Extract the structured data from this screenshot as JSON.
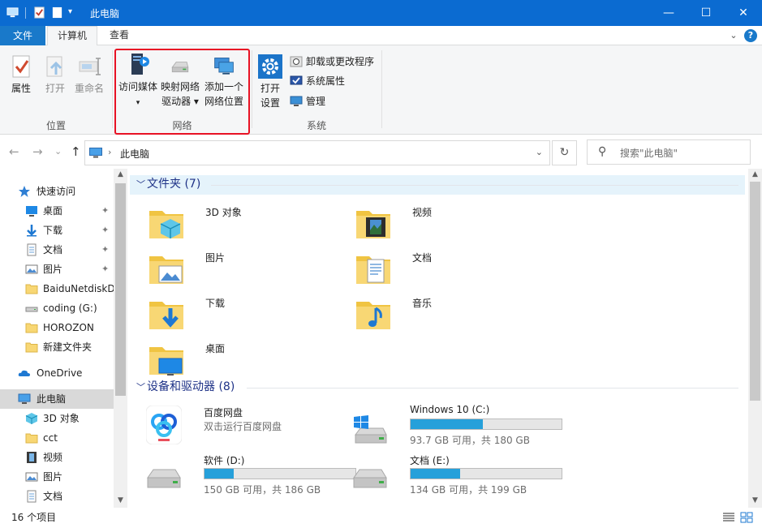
{
  "window": {
    "title": "此电脑",
    "minimize_glyph": "—",
    "maximize_glyph": "☐",
    "close_glyph": "✕"
  },
  "tabs": {
    "file": "文件",
    "computer": "计算机",
    "view": "查看",
    "active": "计算机",
    "expand_glyph": "⌄",
    "help_glyph": "?"
  },
  "ribbon": {
    "location": {
      "label": "位置",
      "properties": "属性",
      "open": "打开",
      "rename": "重命名"
    },
    "network": {
      "label": "网络",
      "access_media": "访问媒体",
      "map_drive_line1": "映射网络",
      "map_drive_line2": "驱动器 ▾",
      "add_location_line1": "添加一个",
      "add_location_line2": "网络位置",
      "dropdown_glyph": "▾"
    },
    "system": {
      "label": "系统",
      "open_settings_line1": "打开",
      "open_settings_line2": "设置",
      "uninstall": "卸载或更改程序",
      "system_properties": "系统属性",
      "manage": "管理"
    }
  },
  "address": {
    "back_glyph": "←",
    "forward_glyph": "→",
    "recent_glyph": "⌄",
    "up_glyph": "↑",
    "crumb_sep": "›",
    "path": "此电脑",
    "dropdown_glyph": "⌄",
    "refresh_glyph": "↻",
    "search_glyph": "⚲",
    "search_placeholder": "搜索\"此电脑\""
  },
  "nav": {
    "items": [
      {
        "label": "快速访问",
        "icon": "star-icon",
        "pinned": false
      },
      {
        "label": "桌面",
        "icon": "desktop-icon",
        "pinned": true
      },
      {
        "label": "下载",
        "icon": "download-icon",
        "pinned": true
      },
      {
        "label": "文档",
        "icon": "document-icon",
        "pinned": true
      },
      {
        "label": "图片",
        "icon": "picture-icon",
        "pinned": true
      },
      {
        "label": "BaiduNetdiskD",
        "icon": "folder-icon",
        "pinned": false
      },
      {
        "label": "coding (G:)",
        "icon": "drive-icon",
        "pinned": false
      },
      {
        "label": "HOROZON",
        "icon": "folder-icon",
        "pinned": false
      },
      {
        "label": "新建文件夹",
        "icon": "folder-icon",
        "pinned": false
      },
      {
        "label": "OneDrive",
        "icon": "cloud-icon",
        "pinned": false
      },
      {
        "label": "此电脑",
        "icon": "computer-icon",
        "pinned": false
      },
      {
        "label": "3D 对象",
        "icon": "3d-objects-icon",
        "pinned": false
      },
      {
        "label": "cct",
        "icon": "folder-icon",
        "pinned": false
      },
      {
        "label": "视频",
        "icon": "video-icon",
        "pinned": false
      },
      {
        "label": "图片",
        "icon": "picture-icon",
        "pinned": false
      },
      {
        "label": "文档",
        "icon": "document-icon",
        "pinned": false
      }
    ],
    "pin_glyph": "📌",
    "scroll_up_glyph": "▲",
    "scroll_down_glyph": "▼"
  },
  "content": {
    "folders_header": "文件夹 (7)",
    "devices_header": "设备和驱动器 (8)",
    "chevron_glyph": "﹀",
    "folders": [
      {
        "name": "3D 对象",
        "icon": "3d-objects-folder-icon"
      },
      {
        "name": "视频",
        "icon": "videos-folder-icon"
      },
      {
        "name": "图片",
        "icon": "pictures-folder-icon"
      },
      {
        "name": "文档",
        "icon": "documents-folder-icon"
      },
      {
        "name": "下载",
        "icon": "downloads-folder-icon"
      },
      {
        "name": "音乐",
        "icon": "music-folder-icon"
      },
      {
        "name": "桌面",
        "icon": "desktop-folder-icon"
      }
    ],
    "devices": [
      {
        "name": "百度网盘",
        "subtitle": "双击运行百度网盘",
        "icon": "baidu-netdisk-icon"
      },
      {
        "name": "Windows 10 (C:)",
        "free": "93.7 GB 可用，共 180 GB",
        "used_fraction": 0.479,
        "icon": "windows-drive-icon"
      },
      {
        "name": "软件 (D:)",
        "free": "150 GB 可用，共 186 GB",
        "used_fraction": 0.194,
        "icon": "hard-drive-icon"
      },
      {
        "name": "文档 (E:)",
        "free": "134 GB 可用，共 199 GB",
        "used_fraction": 0.327,
        "icon": "hard-drive-icon"
      }
    ],
    "bar_color": "#26a0da"
  },
  "status": {
    "item_count": "16 个项目"
  },
  "colors": {
    "title_bar": "#0b6bd1",
    "file_tab": "#1979ca",
    "highlight": "#e81224",
    "section_text": "#1e3287"
  }
}
